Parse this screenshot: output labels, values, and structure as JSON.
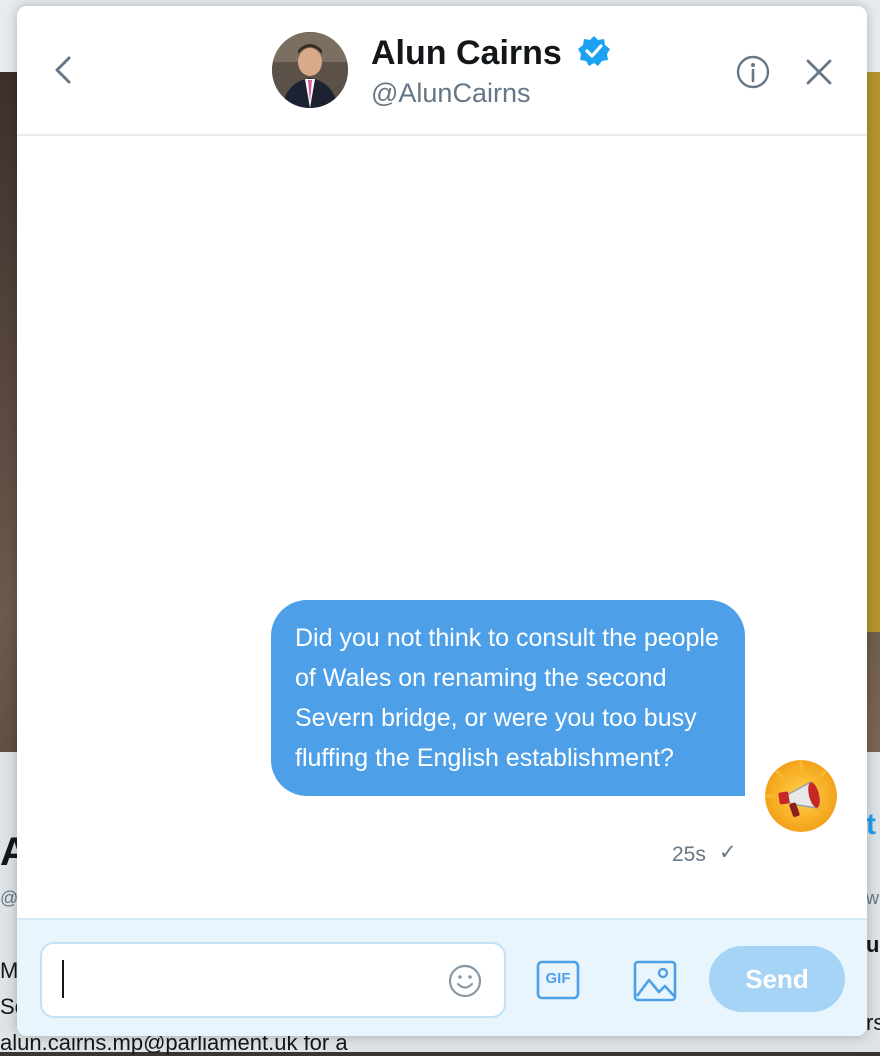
{
  "background": {
    "letter": "A",
    "handle_fragment": "@A",
    "line1": "M",
    "line2": "Se",
    "email_line": "alun.cairns.mp@parliament.uk for a",
    "right_letter_1": "t",
    "right_letter_2": "w",
    "right_letter_3": "u",
    "right_letter_4": "rs"
  },
  "header": {
    "display_name": "Alun Cairns",
    "handle": "@AlunCairns",
    "verified": true
  },
  "conversation": {
    "messages": [
      {
        "text": "Did you not think to consult the people of Wales on renaming the second Severn bridge, or were you too busy fluffing the English establishment?",
        "timestamp": "25s",
        "status": "✓"
      }
    ]
  },
  "composer": {
    "placeholder": "",
    "gif_label": "GIF",
    "send_label": "Send"
  },
  "colors": {
    "accent": "#1da1f2",
    "bubble": "#4da0e8",
    "send_disabled": "#a5d4f7"
  },
  "icons": {
    "back": "chevron-left-icon",
    "verified": "verified-badge-icon",
    "info": "info-icon",
    "close": "close-icon",
    "emoji": "emoji-icon",
    "gif": "gif-icon",
    "image": "image-icon"
  }
}
